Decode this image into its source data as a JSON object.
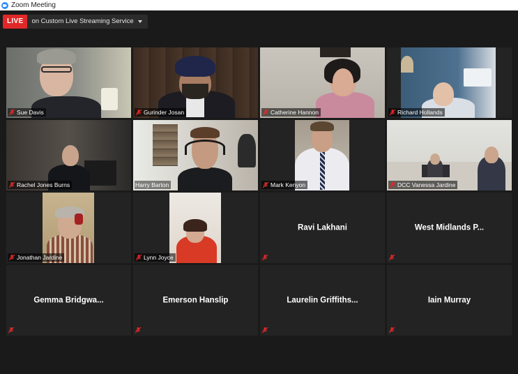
{
  "window": {
    "title": "Zoom Meeting"
  },
  "live": {
    "badge": "LIVE",
    "service": "on Custom Live Streaming Service"
  },
  "colors": {
    "live_red": "#E02828",
    "active_speaker_border": "#d8e86a",
    "muted_mic": "#E02828"
  },
  "participants": [
    {
      "name": "Sue Davis",
      "video": true,
      "muted": true
    },
    {
      "name": "Gurinder Josan",
      "video": true,
      "muted": true
    },
    {
      "name": "Catherine Hannon",
      "video": true,
      "muted": true
    },
    {
      "name": "Richard Hollands",
      "video": true,
      "muted": true
    },
    {
      "name": "Rachel Jones Burns",
      "video": true,
      "muted": true
    },
    {
      "name": "Harry Barton",
      "video": true,
      "muted": false,
      "active_speaker": true
    },
    {
      "name": "Mark Kenyon",
      "video": true,
      "muted": true
    },
    {
      "name": "DCC Vanessa Jardine",
      "video": true,
      "muted": true
    },
    {
      "name": "Jonathan Jardine",
      "video": true,
      "muted": true
    },
    {
      "name": "Lynn Joyce",
      "video": true,
      "muted": true
    },
    {
      "name": "Ravi Lakhani",
      "video": false,
      "muted": true
    },
    {
      "name": "West Midlands P...",
      "video": false,
      "muted": true
    },
    {
      "name": "Gemma  Bridgwa...",
      "video": false,
      "muted": true
    },
    {
      "name": "Emerson Hanslip",
      "video": false,
      "muted": true
    },
    {
      "name": "Laurelin  Griffiths...",
      "video": false,
      "muted": true
    },
    {
      "name": "Iain Murray",
      "video": false,
      "muted": true
    }
  ],
  "icons": {
    "muted_mic": "microphone-muted-icon",
    "app": "zoom-app-icon",
    "dropdown": "chevron-down-icon"
  }
}
